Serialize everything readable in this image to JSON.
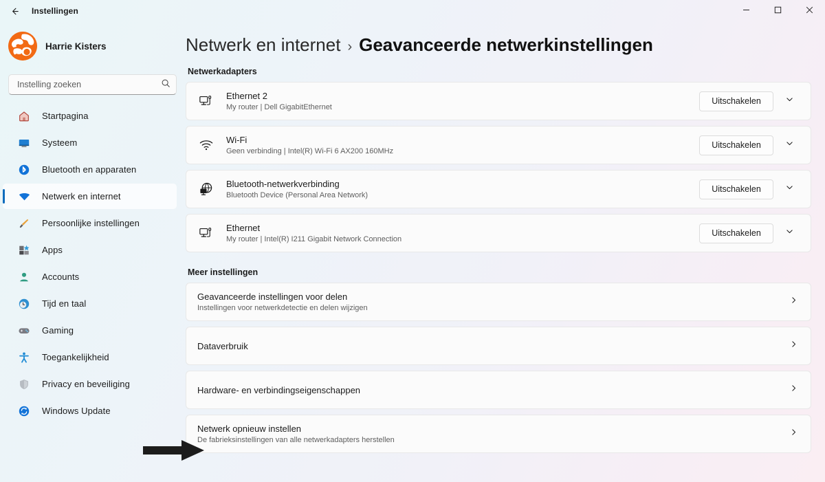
{
  "window": {
    "title": "Instellingen",
    "back_icon": "back-arrow-icon",
    "minimize_label": "─",
    "maximize_label": "□",
    "close_label": "✕"
  },
  "sidebar": {
    "profile": {
      "name": "Harrie Kisters",
      "avatar_icon": "user-avatar-logo"
    },
    "search": {
      "placeholder": "Instelling zoeken",
      "value": "",
      "icon": "search-icon"
    },
    "items": [
      {
        "label": "Startpagina",
        "icon": "home-icon",
        "selected": false
      },
      {
        "label": "Systeem",
        "icon": "system-monitor-icon",
        "selected": false
      },
      {
        "label": "Bluetooth en apparaten",
        "icon": "bluetooth-icon",
        "selected": false
      },
      {
        "label": "Netwerk en internet",
        "icon": "wifi-icon",
        "selected": true
      },
      {
        "label": "Persoonlijke instellingen",
        "icon": "paintbrush-icon",
        "selected": false
      },
      {
        "label": "Apps",
        "icon": "apps-grid-icon",
        "selected": false
      },
      {
        "label": "Accounts",
        "icon": "account-person-icon",
        "selected": false
      },
      {
        "label": "Tijd en taal",
        "icon": "clock-globe-icon",
        "selected": false
      },
      {
        "label": "Gaming",
        "icon": "gamepad-icon",
        "selected": false
      },
      {
        "label": "Toegankelijkheid",
        "icon": "accessibility-person-icon",
        "selected": false
      },
      {
        "label": "Privacy en beveiliging",
        "icon": "shield-icon",
        "selected": false
      },
      {
        "label": "Windows Update",
        "icon": "update-refresh-icon",
        "selected": false
      }
    ]
  },
  "breadcrumb": {
    "parent": "Netwerk en internet",
    "separator": "›",
    "current": "Geavanceerde netwerkinstellingen"
  },
  "adapters_section": {
    "title": "Netwerkadapters",
    "items": [
      {
        "name": "Ethernet 2",
        "detail": "My router | Dell GigabitEthernet",
        "icon": "ethernet-icon",
        "button_label": "Uitschakelen",
        "expand_icon": "chevron-down-icon"
      },
      {
        "name": "Wi-Fi",
        "detail": "Geen verbinding | Intel(R) Wi-Fi 6 AX200 160MHz",
        "icon": "wifi-signal-icon",
        "button_label": "Uitschakelen",
        "expand_icon": "chevron-down-icon"
      },
      {
        "name": "Bluetooth-netwerkverbinding",
        "detail": "Bluetooth Device (Personal Area Network)",
        "icon": "bluetooth-network-icon",
        "button_label": "Uitschakelen",
        "expand_icon": "chevron-down-icon"
      },
      {
        "name": "Ethernet",
        "detail": "My router | Intel(R) I211 Gigabit Network Connection",
        "icon": "ethernet-icon",
        "button_label": "Uitschakelen",
        "expand_icon": "chevron-down-icon"
      }
    ]
  },
  "more_section": {
    "title": "Meer instellingen",
    "items": [
      {
        "name": "Geavanceerde instellingen voor delen",
        "detail": "Instellingen voor netwerkdetectie en delen wijzigen",
        "chevron_icon": "chevron-right-icon"
      },
      {
        "name": "Dataverbruik",
        "detail": "",
        "chevron_icon": "chevron-right-icon"
      },
      {
        "name": "Hardware- en verbindingseigenschappen",
        "detail": "",
        "chevron_icon": "chevron-right-icon"
      },
      {
        "name": "Netwerk opnieuw instellen",
        "detail": "De fabrieksinstellingen van alle netwerkadapters herstellen",
        "chevron_icon": "chevron-right-icon"
      }
    ]
  },
  "annotation": {
    "icon": "black-pointer-arrow",
    "target": "Netwerk opnieuw instellen"
  },
  "colors": {
    "accent": "#0f6cbd",
    "brand_orange": "#f06c10",
    "card_bg": "#fbfbfb",
    "text_primary": "#1b1b1b",
    "text_secondary": "#5e5e5e"
  }
}
